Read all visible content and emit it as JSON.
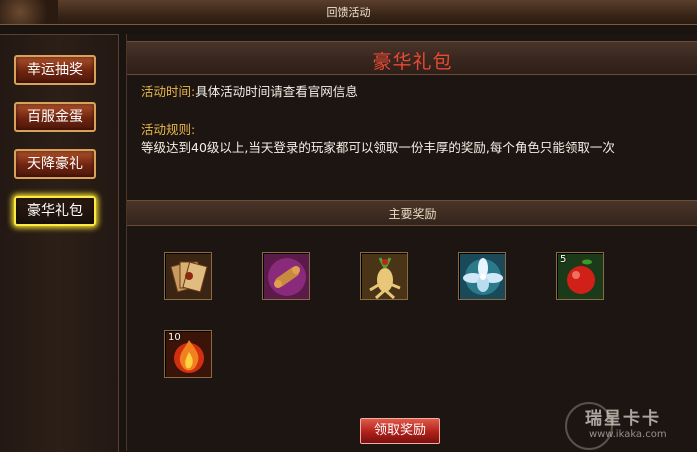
{
  "window": {
    "title": "回馈活动"
  },
  "sidebar": {
    "items": [
      {
        "label": "幸运抽奖",
        "active": false
      },
      {
        "label": "百服金蛋",
        "active": false
      },
      {
        "label": "天降豪礼",
        "active": false
      },
      {
        "label": "豪华礼包",
        "active": true
      }
    ]
  },
  "main": {
    "title": "豪华礼包",
    "time_label": "活动时间:",
    "time_value": "具体活动时间请查看官网信息",
    "rules_label": "活动规则:",
    "rules_text": "等级达到40级以上,当天登录的玩家都可以领取一份丰厚的奖励,每个角色只能领取一次",
    "rewards_section_title": "主要奖励",
    "rewards": [
      {
        "icon": "cards-icon",
        "count": ""
      },
      {
        "icon": "scroll-icon",
        "count": ""
      },
      {
        "icon": "ginseng-icon",
        "count": ""
      },
      {
        "icon": "lotus-icon",
        "count": ""
      },
      {
        "icon": "apple-icon",
        "count": "5"
      },
      {
        "icon": "fire-orb-icon",
        "count": "10"
      }
    ],
    "claim_button": "领取奖励"
  },
  "watermark": {
    "title": "瑞星卡卡",
    "url": "www.ikaka.com"
  },
  "colors": {
    "title_red": "#e84a34",
    "label_gold": "#e8b84a",
    "active_glow": "#f2e030",
    "button_red": "#b0201a"
  }
}
